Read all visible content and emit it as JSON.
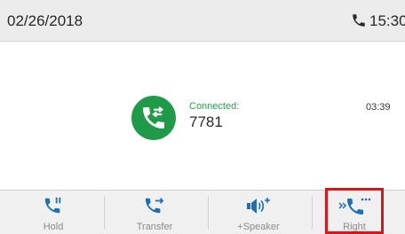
{
  "status_bar": {
    "date": "02/26/2018",
    "time": "15:30",
    "icon": "phone-icon"
  },
  "call": {
    "status": "Connected:",
    "number": "7781",
    "duration": "03:39",
    "icon": "active-call-icon",
    "accent_color": "#1f9a48"
  },
  "softkeys": [
    {
      "label": "Hold",
      "icon": "hold-icon"
    },
    {
      "label": "Transfer",
      "icon": "transfer-icon"
    },
    {
      "label": "+Speaker",
      "icon": "speaker-icon"
    },
    {
      "label": "Right",
      "icon": "more-icon"
    }
  ],
  "highlight_color": "#d9141b"
}
